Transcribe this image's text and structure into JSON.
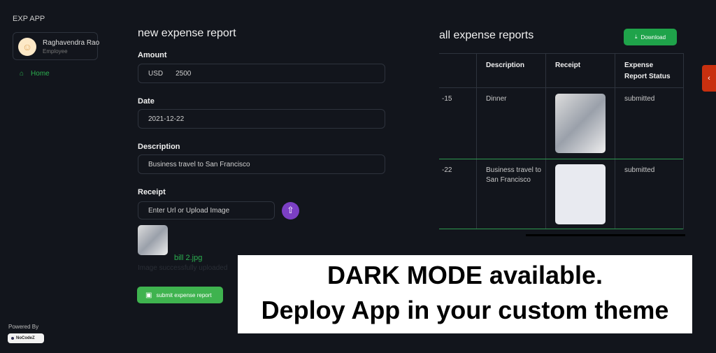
{
  "app": {
    "title": "EXP APP"
  },
  "user": {
    "name": "Raghavendra Rao",
    "role": "Employee"
  },
  "sidebar": {
    "items": [
      {
        "label": "Home",
        "icon": "home-icon"
      }
    ]
  },
  "form": {
    "title": "new expense report",
    "amount_label": "Amount",
    "currency": "USD",
    "amount": "2500",
    "date_label": "Date",
    "date": "2021-12-22",
    "description_label": "Description",
    "description": "Business travel to San Francisco",
    "receipt_label": "Receipt",
    "receipt_placeholder": "Enter Url or Upload Image",
    "file_name": "bill 2.jpg",
    "upload_status": "Image successfully uploaded",
    "submit_label": "submit expense report"
  },
  "reports": {
    "title": "all expense reports",
    "download_label": "Download",
    "columns": [
      "Description",
      "Receipt",
      "Expense Report Status"
    ],
    "rows": [
      {
        "date": "-15",
        "description": "Dinner",
        "status": "submitted"
      },
      {
        "date": "-22",
        "description": "Business travel to San Francisco",
        "status": "submitted"
      }
    ]
  },
  "footer": {
    "powered_by": "Powered By",
    "brand": "NoCodeZ"
  },
  "banner": {
    "line1": "DARK MODE available.",
    "line2": "Deploy App in your custom theme"
  },
  "colors": {
    "accent": "#22a045",
    "primary": "#1fa34a",
    "purple": "#7b3fc4",
    "tab": "#c8300f"
  }
}
